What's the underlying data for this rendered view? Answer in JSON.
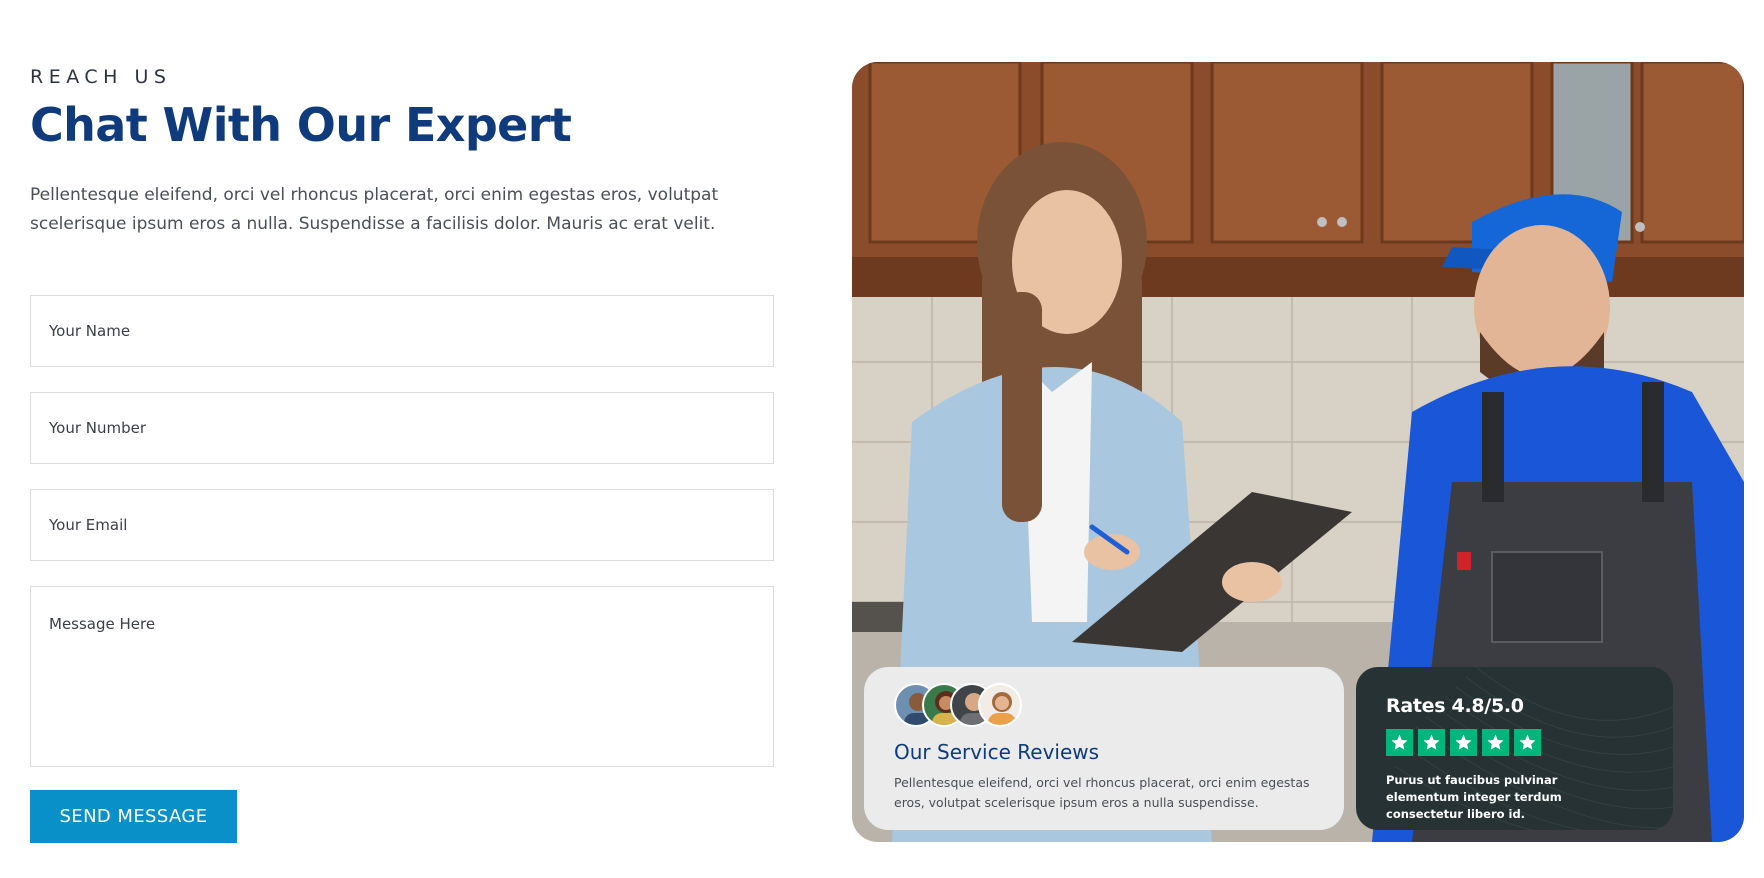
{
  "header": {
    "eyebrow": "REACH US",
    "title": "Chat With Our Expert",
    "description": "Pellentesque eleifend, orci vel rhoncus placerat, orci enim egestas eros, volutpat scelerisque ipsum eros a nulla. Suspendisse a facilisis dolor. Mauris ac erat velit."
  },
  "form": {
    "name_placeholder": "Your Name",
    "number_placeholder": "Your Number",
    "email_placeholder": "Your Email",
    "message_placeholder": "Message Here",
    "submit_label": "SEND MESSAGE"
  },
  "reviews_card": {
    "title": "Our Service Reviews",
    "text": "Pellentesque eleifend, orci vel rhoncus placerat, orci enim egestas eros, volutpat scelerisque ipsum eros a nulla suspendisse.",
    "avatar_count": 4
  },
  "rating_card": {
    "title": "Rates 4.8/5.0",
    "stars": 5,
    "text": "Purus ut faucibus pulvinar elementum integer terdum consectetur libero id."
  },
  "colors": {
    "title_blue": "#0f3b7c",
    "button_blue": "#0a90c9",
    "star_green": "#00b67a",
    "rating_bg": "#263233",
    "review_bg": "#ebebeb"
  }
}
